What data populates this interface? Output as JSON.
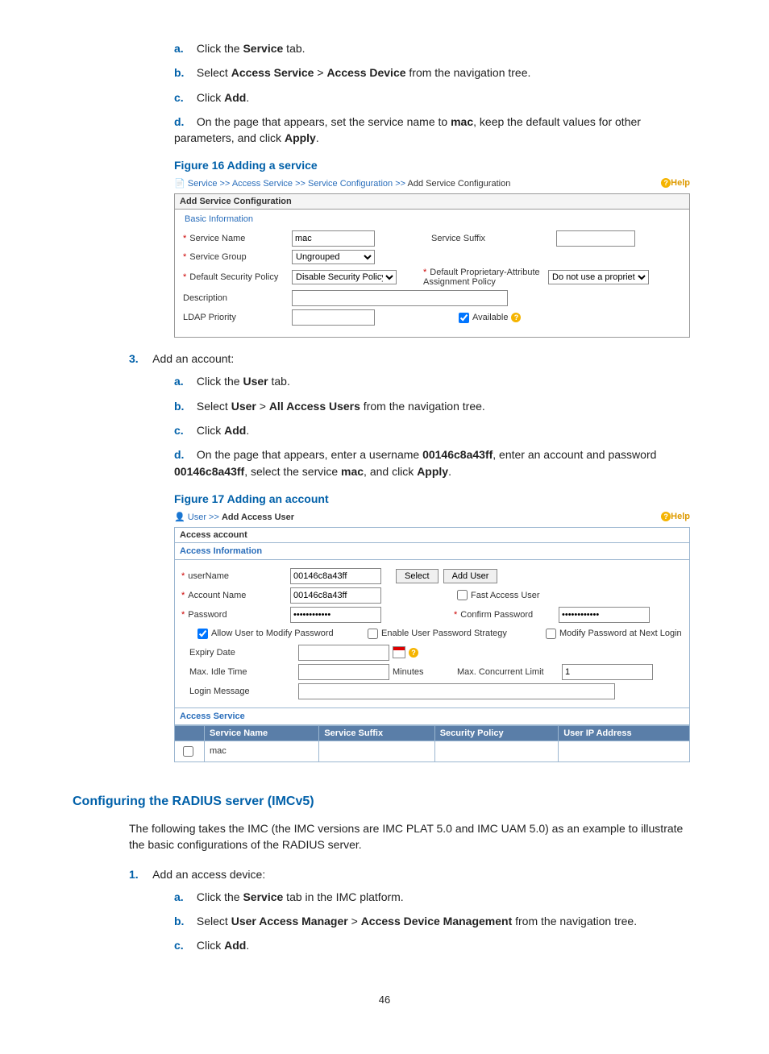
{
  "step_a": {
    "letter": "a.",
    "text_pre": "Click the ",
    "bold": "Service",
    "text_post": " tab."
  },
  "step_b": {
    "letter": "b.",
    "t1": "Select ",
    "b1": "Access Service",
    "t2": " > ",
    "b2": "Access Device",
    "t3": " from the navigation tree."
  },
  "step_c": {
    "letter": "c.",
    "t1": "Click ",
    "b1": "Add",
    "t2": "."
  },
  "step_d": {
    "letter": "d.",
    "t1": "On the page that appears, set the service name to ",
    "b1": "mac",
    "t2": ", keep the default values for other parameters, and click ",
    "b2": "Apply",
    "t3": "."
  },
  "fig16_caption": "Figure 16 Adding a service",
  "fig16": {
    "breadcrumb": {
      "a": "Service",
      "b": "Access Service",
      "c": "Service Configuration",
      "d": "Add Service Configuration",
      "sep": " >> "
    },
    "help": "Help",
    "title": "Add Service Configuration",
    "legend": "Basic Information",
    "svc_name_lbl": "Service Name",
    "svc_name_val": "mac",
    "svc_suffix_lbl": "Service Suffix",
    "svc_suffix_val": "",
    "svc_group_lbl": "Service Group",
    "svc_group_val": "Ungrouped",
    "sec_policy_lbl": "Default Security Policy",
    "sec_policy_val": "Disable Security Policy",
    "prop_attr_lbl": "Default Proprietary-Attribute Assignment Policy",
    "prop_attr_val": "Do not use a proprietar",
    "desc_lbl": "Description",
    "desc_val": "",
    "ldap_lbl": "LDAP Priority",
    "ldap_val": "",
    "avail_lbl": "Available"
  },
  "step3": {
    "num": "3.",
    "text": "Add an account:"
  },
  "s3a": {
    "letter": "a.",
    "t1": "Click the ",
    "b1": "User",
    "t2": " tab."
  },
  "s3b": {
    "letter": "b.",
    "t1": "Select ",
    "b1": "User",
    "t2": " > ",
    "b2": "All Access Users",
    "t3": " from the navigation tree."
  },
  "s3c": {
    "letter": "c.",
    "t1": "Click ",
    "b1": "Add",
    "t2": "."
  },
  "s3d": {
    "letter": "d.",
    "t1": "On the page that appears, enter a username ",
    "b1": "00146c8a43ff",
    "t2": ", enter an account and password ",
    "b2": "00146c8a43ff",
    "t3": ", select the service ",
    "b3": "mac",
    "t4": ", and click ",
    "b4": "Apply",
    "t5": "."
  },
  "fig17_caption": "Figure 17 Adding an account",
  "fig17": {
    "breadcrumb": {
      "a": "User",
      "b": "Add Access User",
      "sep": " >> "
    },
    "help": "Help",
    "title": "Access account",
    "section": "Access Information",
    "username_lbl": "userName",
    "username_val": "00146c8a43ff",
    "select_btn": "Select",
    "adduser_btn": "Add User",
    "account_lbl": "Account Name",
    "account_val": "00146c8a43ff",
    "fast_lbl": "Fast Access User",
    "pwd_lbl": "Password",
    "pwd_masked": "••••••••••••",
    "cpwd_lbl": "Confirm Password",
    "cpwd_masked": "••••••••••••",
    "allow_lbl": "Allow User to Modify Password",
    "strategy_lbl": "Enable User Password Strategy",
    "nextlogin_lbl": "Modify Password at Next Login",
    "expiry_lbl": "Expiry Date",
    "expiry_val": "",
    "idle_lbl": "Max. Idle Time",
    "idle_val": "",
    "minutes": "Minutes",
    "concurrent_lbl": "Max. Concurrent Limit",
    "concurrent_val": "1",
    "login_msg_lbl": "Login Message",
    "login_msg_val": "",
    "section2": "Access Service",
    "th1": "Service Name",
    "th2": "Service Suffix",
    "th3": "Security Policy",
    "th4": "User IP Address",
    "row_name": "mac"
  },
  "h3": "Configuring the RADIUS server (IMCv5)",
  "para": "The following takes the IMC (the IMC versions are IMC PLAT 5.0 and IMC UAM 5.0) as an example to illustrate the basic configurations of the RADIUS server.",
  "s1": {
    "num": "1.",
    "text": "Add an access device:"
  },
  "s1a": {
    "letter": "a.",
    "t1": "Click the ",
    "b1": "Service",
    "t2": " tab in the IMC platform."
  },
  "s1b": {
    "letter": "b.",
    "t1": "Select ",
    "b1": "User Access Manager",
    "t2": " > ",
    "b2": "Access Device Management",
    "t3": " from the navigation tree."
  },
  "s1c": {
    "letter": "c.",
    "t1": "Click ",
    "b1": "Add",
    "t2": "."
  },
  "pagenum": "46"
}
